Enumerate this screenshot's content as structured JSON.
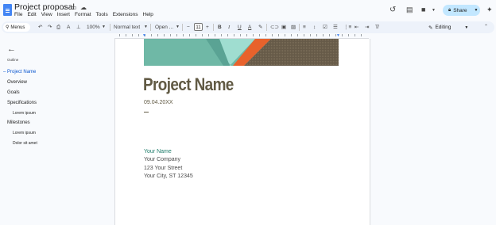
{
  "app": {
    "doc_title": "Project proposal",
    "menu": [
      "File",
      "Edit",
      "View",
      "Insert",
      "Format",
      "Tools",
      "Extensions",
      "Help"
    ],
    "share_label": "Share"
  },
  "toolbar": {
    "menus_label": "Menus",
    "zoom": "100%",
    "style": "Normal text",
    "font": "Open ...",
    "font_size": "11",
    "mode": "Editing"
  },
  "outline": {
    "heading": "Outline",
    "items": [
      {
        "label": "Project Name"
      },
      {
        "label": "Overview"
      },
      {
        "label": "Goals"
      },
      {
        "label": "Specifications"
      },
      {
        "label": "Lorem ipsum"
      },
      {
        "label": "Milestones"
      },
      {
        "label": "Lorem ipsum"
      },
      {
        "label": "Dolor sit amet"
      }
    ]
  },
  "document": {
    "title": "Project Name",
    "date": "09.04.20XX",
    "contact_name": "Your Name",
    "company": "Your Company",
    "street": "123 Your Street",
    "city": "Your City, ST 12345"
  },
  "colors": {
    "title": "#615a44",
    "accent_teal": "#1e7c6a",
    "banner_teal": "#6fb8a6",
    "banner_orange": "#e8622c",
    "banner_brown": "#665a48",
    "share_bg": "#c2e7ff",
    "outline_active": "#0b57d0"
  }
}
